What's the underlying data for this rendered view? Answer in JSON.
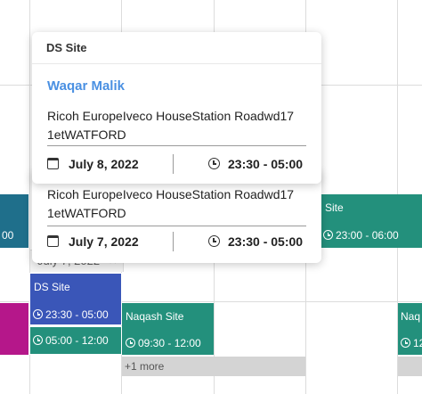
{
  "colors": {
    "teal": "#23907c",
    "magenta": "#b5178a",
    "blue": "#3a56b8",
    "dark_blue_teal": "#1f6f8b",
    "name_blue": "#4a90e2",
    "more_gray": "#d4d4d4"
  },
  "events": {
    "left_partial_time": "00",
    "right_site_label": "Site",
    "right_site_time": "23:00 - 06:00",
    "ds_site_label": "DS Site",
    "ds_site_time": "23:30 - 05:00",
    "bottom_left_time": "05:00 - 12:00",
    "naqash_label": "Naqash Site",
    "naqash_time": "09:30 - 12:00",
    "far_right_label": "Naq",
    "far_right_time": "12"
  },
  "more_link": "+1 more",
  "date_pill": {
    "label": "July 7, 2022",
    "close": "×"
  },
  "popup_back": {
    "address_line1": "Ricoh EuropeIveco HouseStation Roadwd17",
    "address_line2": "1etWATFORD",
    "date": "July 7, 2022",
    "time": "23:30 - 05:00"
  },
  "popup_front": {
    "site": "DS Site",
    "name": "Waqar Malik",
    "address_line1": "Ricoh EuropeIveco HouseStation Roadwd17",
    "address_line2": "1etWATFORD",
    "date": "July 8, 2022",
    "time": "23:30 - 05:00"
  }
}
